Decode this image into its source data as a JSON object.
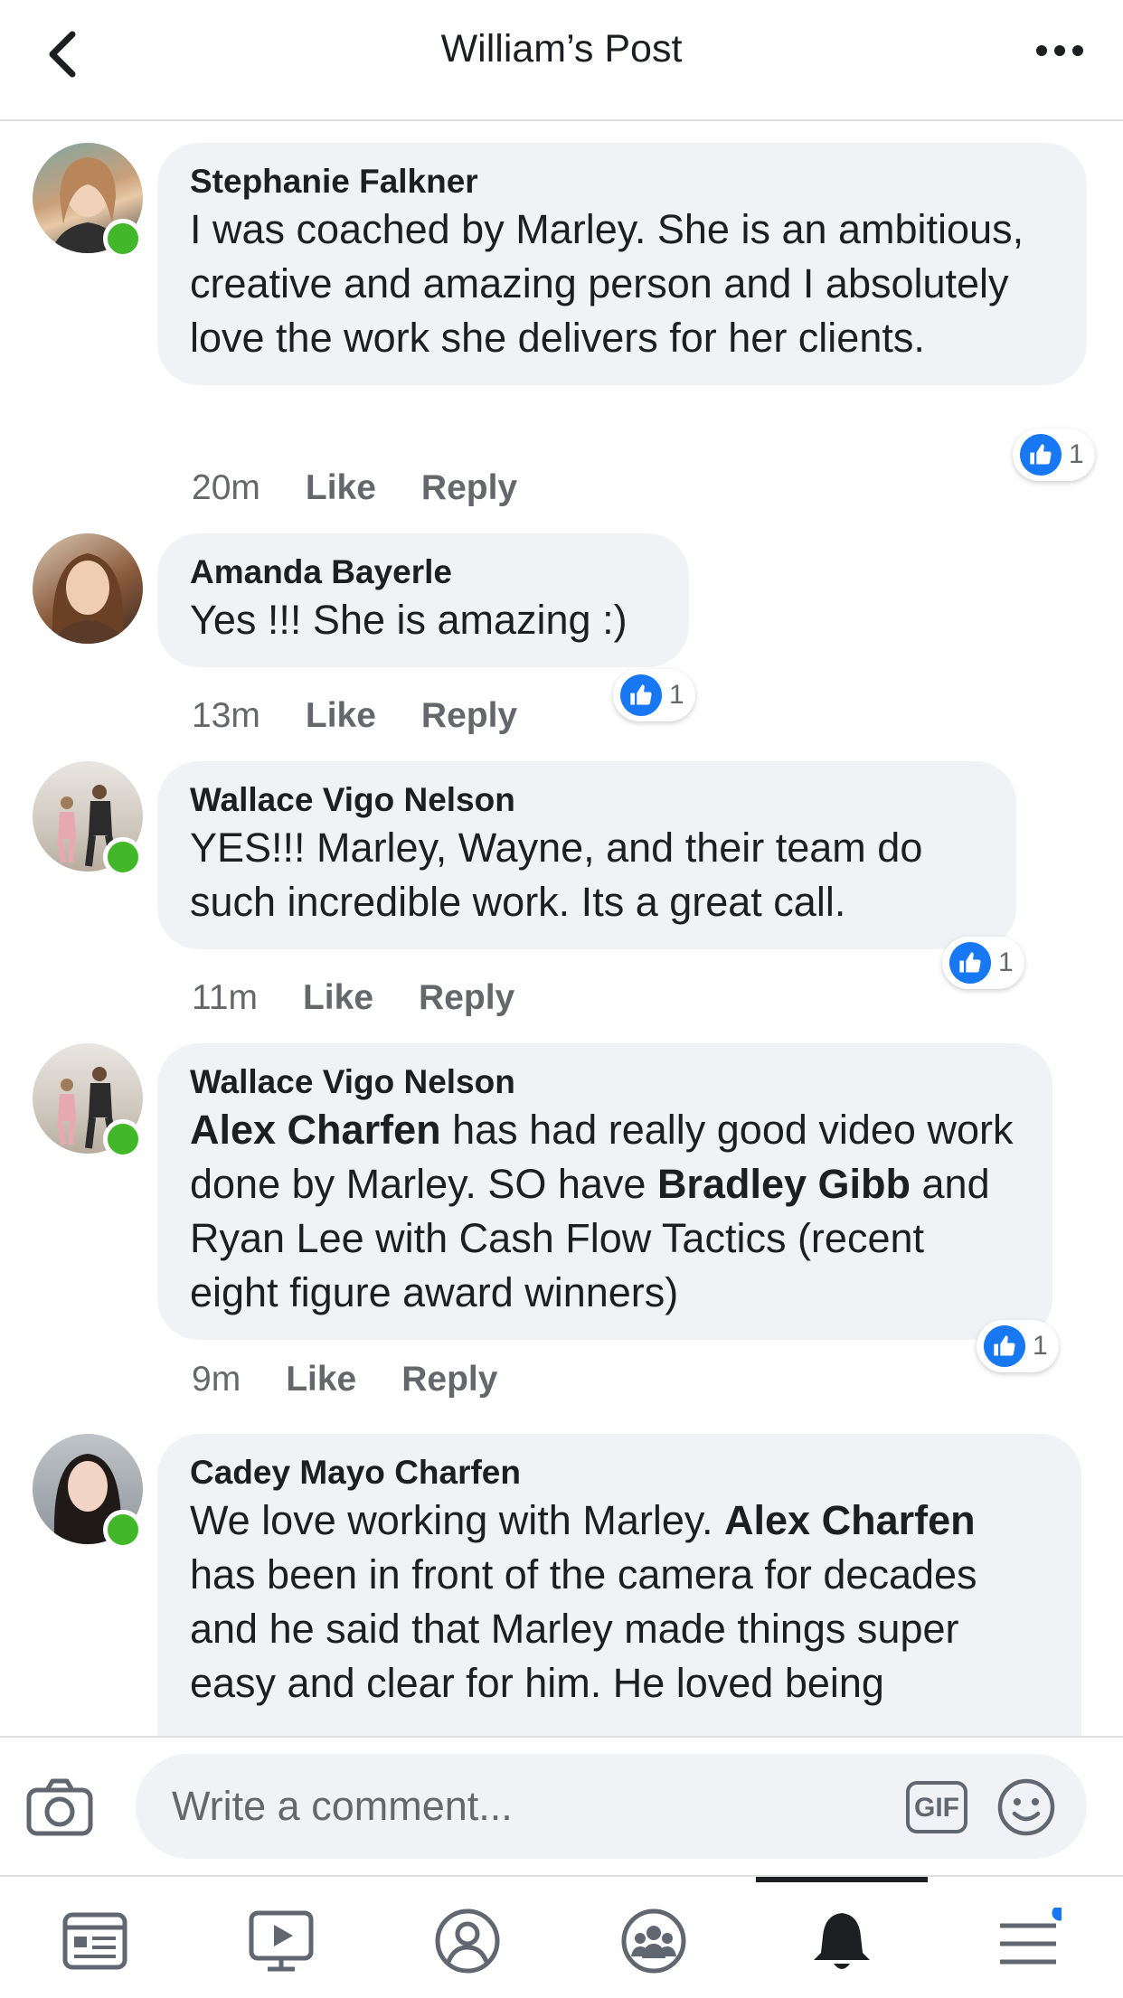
{
  "header": {
    "title": "William’s Post",
    "back_icon": "chevron-left-icon",
    "more_icon": "ellipsis-icon"
  },
  "comments": [
    {
      "author": "Stephanie Falkner",
      "text": "I was coached by Marley. She is an ambitious, creative and amazing person and I absolutely love the work she delivers for her clients.",
      "time": "20m",
      "like_label": "Like",
      "reply_label": "Reply",
      "reactions": "1",
      "online": true
    },
    {
      "author": "Amanda Bayerle",
      "text": "Yes !!! She is amazing :)",
      "time": "13m",
      "like_label": "Like",
      "reply_label": "Reply",
      "reactions": "1",
      "online": false
    },
    {
      "author": "Wallace Vigo Nelson",
      "text": "YES!!!  Marley, Wayne, and their team do such incredible work.  Its a great call.",
      "time": "11m",
      "like_label": "Like",
      "reply_label": "Reply",
      "reactions": "1",
      "online": true
    },
    {
      "author": "Wallace Vigo Nelson",
      "parts": [
        "Alex Charfen",
        " has had really good video work done by Marley.  SO have ",
        "Bradley Gibb",
        " and Ryan Lee with Cash Flow Tactics (recent eight figure award winners)"
      ],
      "time": "9m",
      "like_label": "Like",
      "reply_label": "Reply",
      "reactions": "1",
      "online": true
    },
    {
      "author": "Cadey Mayo Charfen",
      "parts": [
        "We love working with Marley.  ",
        "Alex Charfen",
        " has been in front of the camera for decades and he said that Marley made things super easy and clear for him.  He loved being"
      ],
      "online": true
    }
  ],
  "composer": {
    "placeholder": "Write a comment...",
    "gif_label": "GIF",
    "camera_icon": "camera-icon",
    "emoji_icon": "smiley-icon"
  },
  "nav": {
    "items": [
      "news-feed-icon",
      "watch-icon",
      "profile-icon",
      "groups-icon",
      "notifications-icon",
      "menu-icon"
    ],
    "active": "notifications-icon"
  },
  "colors": {
    "bubble": "#f0f2f5",
    "like_blue": "#1877f2",
    "online_green": "#42b72a",
    "meta_gray": "#65676b"
  }
}
